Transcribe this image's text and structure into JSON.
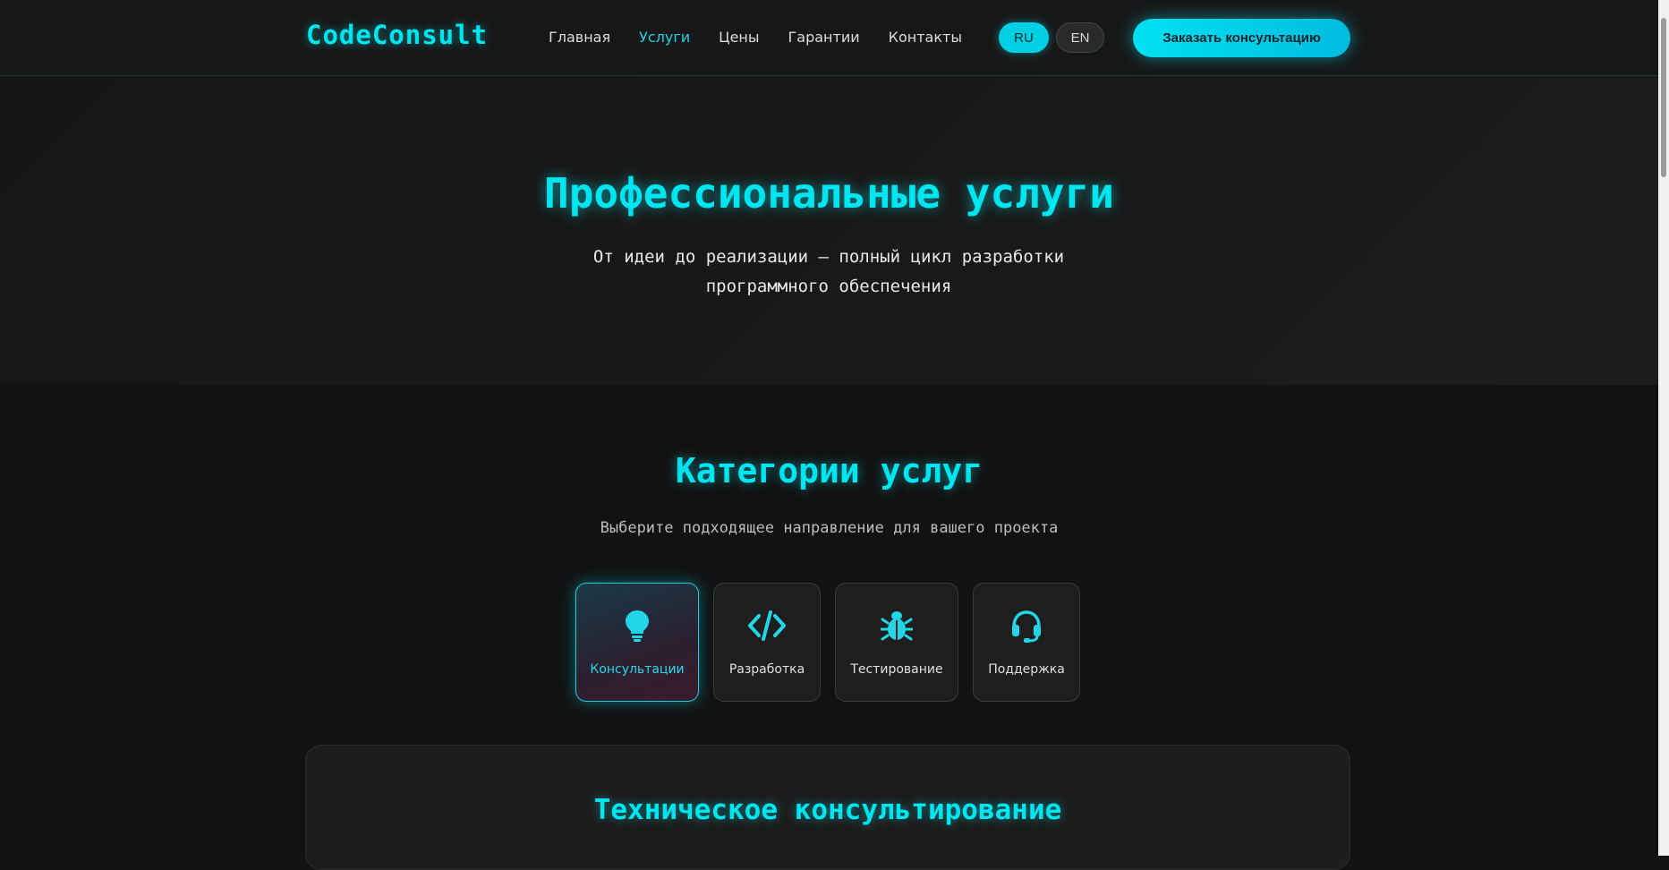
{
  "header": {
    "logo": "CodeConsult",
    "nav": [
      {
        "label": "Главная"
      },
      {
        "label": "Услуги"
      },
      {
        "label": "Цены"
      },
      {
        "label": "Гарантии"
      },
      {
        "label": "Контакты"
      }
    ],
    "active_nav": "Услуги",
    "lang_ru": "RU",
    "lang_en": "EN",
    "active_lang": "RU",
    "cta_label": "Заказать консультацию"
  },
  "hero": {
    "title": "Профессиональные услуги",
    "subtitle": "От идеи до реализации – полный цикл разработки программного обеспечения"
  },
  "categories_section": {
    "title": "Категории услуг",
    "subtitle": "Выберите подходящее направление для вашего проекта",
    "items": [
      {
        "label": "Консультации",
        "icon": "lightbulb-icon"
      },
      {
        "label": "Разработка",
        "icon": "code-icon"
      },
      {
        "label": "Тестирование",
        "icon": "bug-icon"
      },
      {
        "label": "Поддержка",
        "icon": "headset-icon"
      }
    ],
    "active": "Консультации"
  },
  "detail": {
    "title": "Техническое консультирование"
  },
  "colors": {
    "accent": "#00e6f0",
    "background": "#121212",
    "cta": "#00d4ec"
  }
}
